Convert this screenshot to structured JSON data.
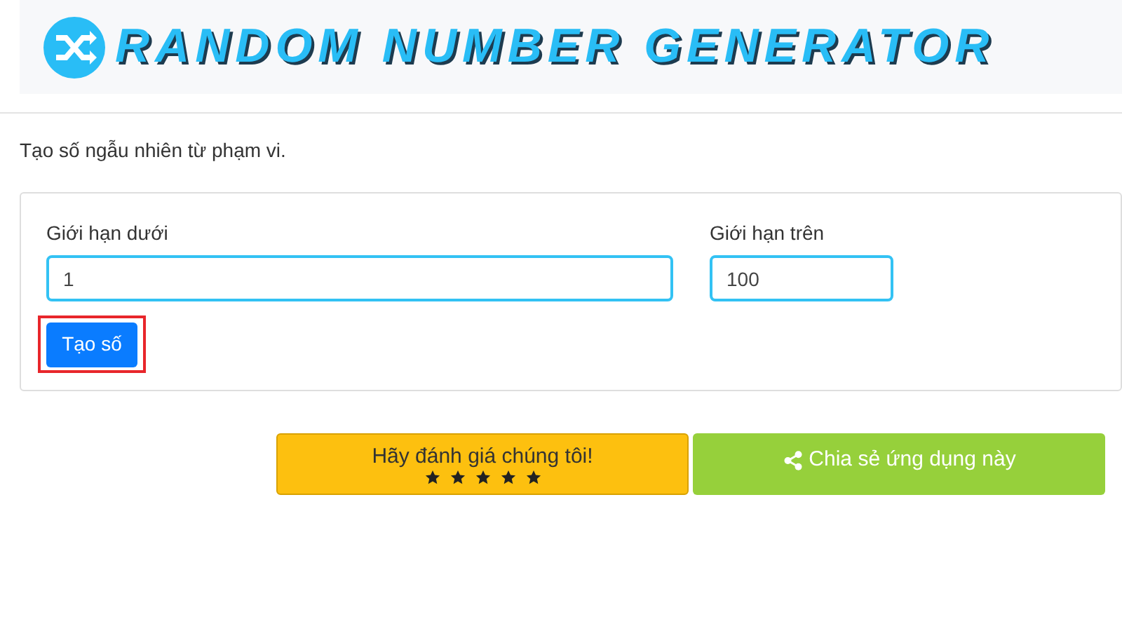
{
  "header": {
    "title": "RANDOM NUMBER GENERATOR"
  },
  "intro": "Tạo số ngẫu nhiên từ phạm vi.",
  "form": {
    "fields": [
      {
        "label": "Giới hạn dưới",
        "value": "1"
      },
      {
        "label": "Giới hạn trên",
        "value": "100"
      }
    ],
    "button": {
      "label": "Tạo số",
      "highlighted": true
    }
  },
  "rate": {
    "label": "Hãy đánh giá chúng tôi!",
    "stars": 5
  },
  "share": {
    "label": "Chia sẻ ứng dụng này"
  }
}
